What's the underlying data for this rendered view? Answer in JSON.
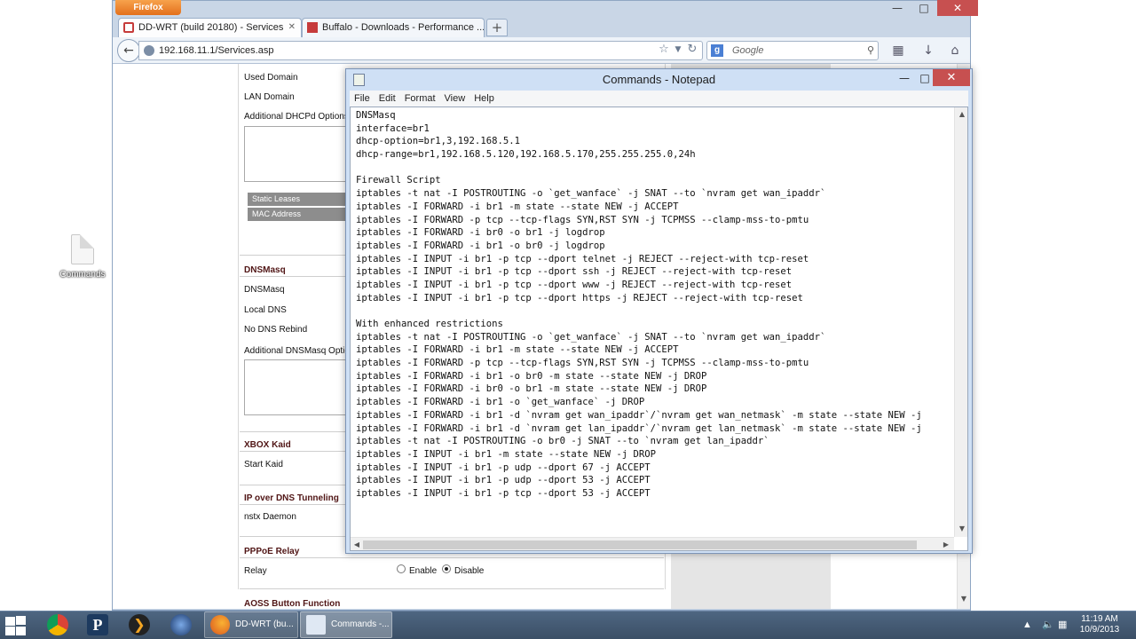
{
  "desktop": {
    "icon_label": "Commands"
  },
  "firefox": {
    "menu_button": "Firefox",
    "tabs": [
      {
        "label": "DD-WRT (build 20180) - Services"
      },
      {
        "label": "Buffalo - Downloads - Performance ..."
      }
    ],
    "url": "192.168.11.1/Services.asp",
    "search_placeholder": "Google"
  },
  "webpage": {
    "labels": {
      "used_domain": "Used Domain",
      "lan_domain": "LAN Domain",
      "additional_dhcpd": "Additional DHCPd Options",
      "static_leases": "Static Leases",
      "mac_address": "MAC Address",
      "dnsmasq": "DNSMasq",
      "local_dns": "Local DNS",
      "no_dns_rebind": "No DNS Rebind",
      "additional_dnsmasq": "Additional DNSMasq Options",
      "start_kaid": "Start Kaid",
      "nstx_daemon": "nstx Daemon",
      "relay": "Relay",
      "enable": "Enable",
      "disable": "Disable"
    },
    "sections": {
      "dnsmasq": "DNSMasq",
      "xbox": "XBOX Kaid",
      "ip_dns": "IP over DNS Tunneling",
      "pppoe": "PPPoE Relay",
      "aoss": "AOSS Button Function"
    },
    "relay_selected": "Disable"
  },
  "notepad": {
    "title": "Commands - Notepad",
    "menu": [
      "File",
      "Edit",
      "Format",
      "View",
      "Help"
    ],
    "lines": [
      "DNSMasq",
      "interface=br1",
      "dhcp-option=br1,3,192.168.5.1",
      "dhcp-range=br1,192.168.5.120,192.168.5.170,255.255.255.0,24h",
      "",
      "Firewall Script",
      "iptables -t nat -I POSTROUTING -o `get_wanface` -j SNAT --to `nvram get wan_ipaddr`",
      "iptables -I FORWARD -i br1 -m state --state NEW -j ACCEPT",
      "iptables -I FORWARD -p tcp --tcp-flags SYN,RST SYN -j TCPMSS --clamp-mss-to-pmtu",
      "iptables -I FORWARD -i br0 -o br1 -j logdrop",
      "iptables -I FORWARD -i br1 -o br0 -j logdrop",
      "iptables -I INPUT -i br1 -p tcp --dport telnet -j REJECT --reject-with tcp-reset",
      "iptables -I INPUT -i br1 -p tcp --dport ssh -j REJECT --reject-with tcp-reset",
      "iptables -I INPUT -i br1 -p tcp --dport www -j REJECT --reject-with tcp-reset",
      "iptables -I INPUT -i br1 -p tcp --dport https -j REJECT --reject-with tcp-reset",
      "",
      "With enhanced restrictions",
      "iptables -t nat -I POSTROUTING -o `get_wanface` -j SNAT --to `nvram get wan_ipaddr`",
      "iptables -I FORWARD -i br1 -m state --state NEW -j ACCEPT",
      "iptables -I FORWARD -p tcp --tcp-flags SYN,RST SYN -j TCPMSS --clamp-mss-to-pmtu",
      "iptables -I FORWARD -i br1 -o br0 -m state --state NEW -j DROP",
      "iptables -I FORWARD -i br0 -o br1 -m state --state NEW -j DROP",
      "iptables -I FORWARD -i br1 -o `get_wanface` -j DROP",
      "iptables -I FORWARD -i br1 -d `nvram get wan_ipaddr`/`nvram get wan_netmask` -m state --state NEW -j",
      "iptables -I FORWARD -i br1 -d `nvram get lan_ipaddr`/`nvram get lan_netmask` -m state --state NEW -j",
      "iptables -t nat -I POSTROUTING -o br0 -j SNAT --to `nvram get lan_ipaddr`",
      "iptables -I INPUT -i br1 -m state --state NEW -j DROP",
      "iptables -I INPUT -i br1 -p udp --dport 67 -j ACCEPT",
      "iptables -I INPUT -i br1 -p udp --dport 53 -j ACCEPT",
      "iptables -I INPUT -i br1 -p tcp --dport 53 -j ACCEPT"
    ]
  },
  "taskbar": {
    "buttons": [
      {
        "label": "DD-WRT (bu..."
      },
      {
        "label": "Commands -..."
      }
    ],
    "time": "11:19 AM",
    "date": "10/9/2013"
  },
  "colors": {
    "firefox_orange": "#e3701c",
    "close_red": "#c75050",
    "section_head": "#501515",
    "taskbar": "#3b4f66"
  }
}
